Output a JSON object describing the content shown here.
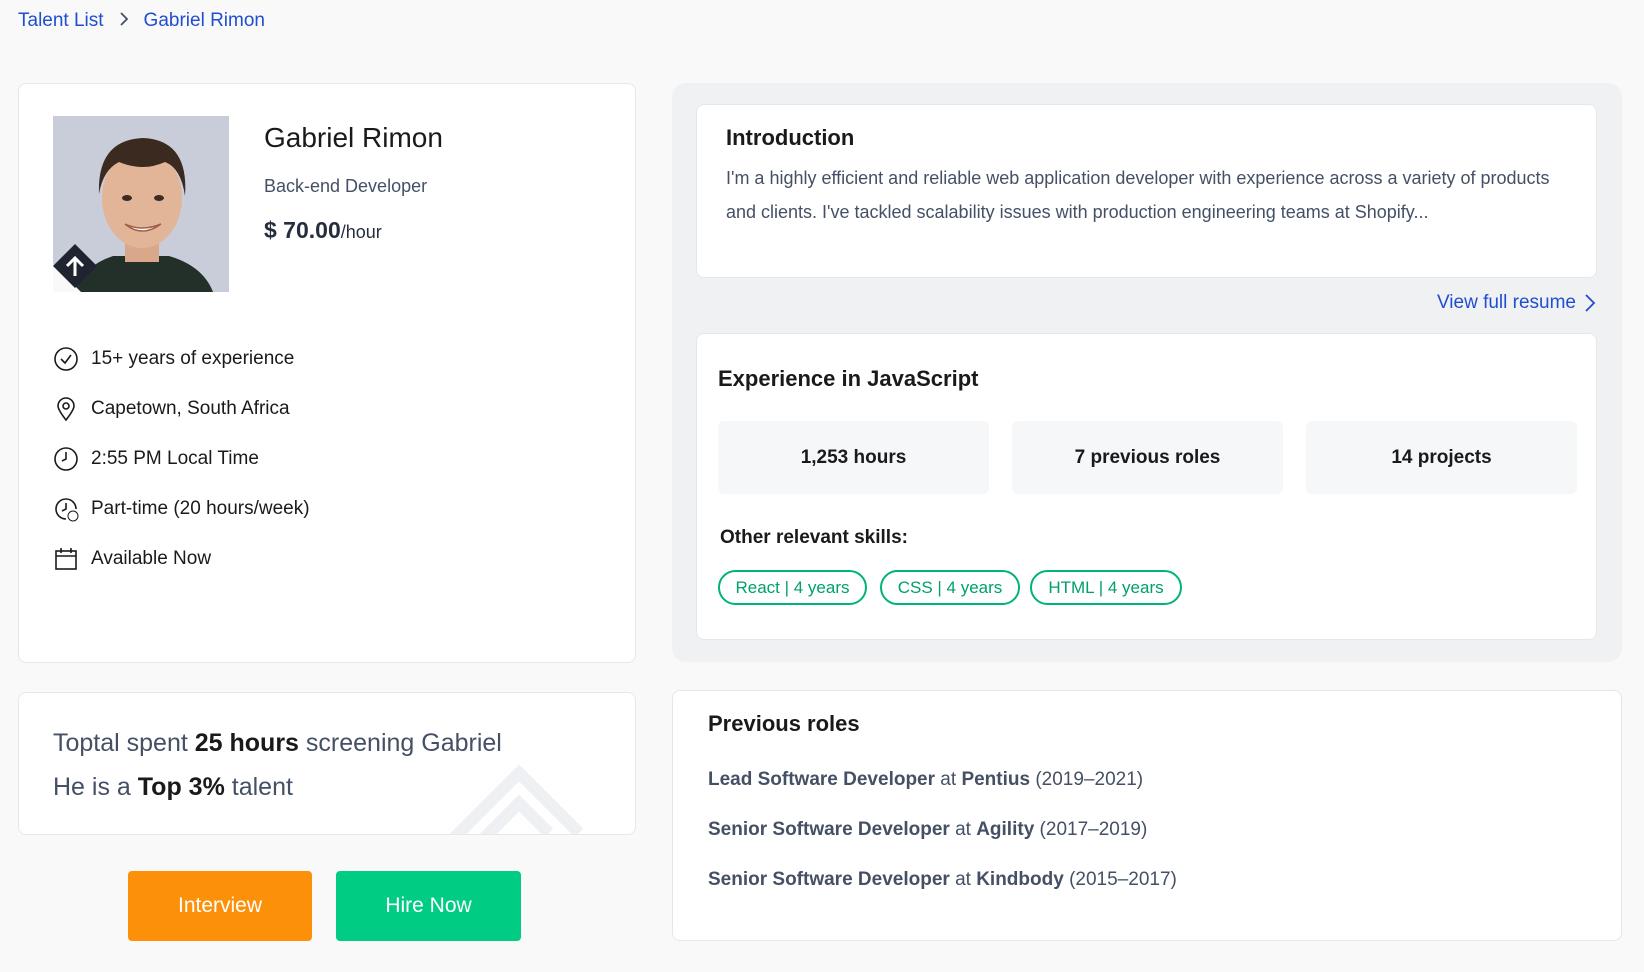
{
  "breadcrumb": {
    "parent": "Talent List",
    "separator": ">",
    "current": "Gabriel Rimon"
  },
  "profile": {
    "name": "Gabriel Rimon",
    "role": "Back-end Developer",
    "rate_amount": "$ 70.00",
    "rate_unit": "/hour",
    "facts": [
      {
        "icon": "check-circle-icon",
        "text": "15+ years of experience"
      },
      {
        "icon": "location-pin-icon",
        "text": "Capetown, South Africa"
      },
      {
        "icon": "clock-icon",
        "text": "2:55 PM Local Time"
      },
      {
        "icon": "part-time-clock-icon",
        "text": "Part-time (20 hours/week)"
      },
      {
        "icon": "calendar-icon",
        "text": "Available Now"
      }
    ]
  },
  "screening": {
    "line1_pre": "Toptal spent ",
    "line1_bold": "25 hours",
    "line1_post": " screening Gabriel",
    "line2_pre": "He is a ",
    "line2_bold": "Top 3%",
    "line2_post": " talent"
  },
  "actions": {
    "interview": "Interview",
    "hire": "Hire Now"
  },
  "introduction": {
    "title": "Introduction",
    "text": "I'm a highly efficient and reliable web application developer with experience across a variety of products and clients. I've tackled scalability issues with production engineering teams at Shopify...",
    "resume_link": "View full resume"
  },
  "experience": {
    "title": "Experience in JavaScript",
    "stats": [
      "1,253 hours",
      "7 previous roles",
      "14 projects"
    ],
    "skills_label": "Other relevant skills:",
    "skills": [
      "React | 4 years",
      "CSS | 4 years",
      "HTML | 4 years"
    ]
  },
  "previous_roles": {
    "title": "Previous roles",
    "connector": " at ",
    "items": [
      {
        "role": "Lead Software Developer",
        "company": "Pentius",
        "years": " (2019–2021)"
      },
      {
        "role": "Senior Software Developer",
        "company": "Agility",
        "years": " (2017–2019)"
      },
      {
        "role": "Senior Software Developer",
        "company": "Kindbody",
        "years": " (2015–2017)"
      }
    ]
  },
  "colors": {
    "link_blue": "#204ecf",
    "interview_orange": "#fc9008",
    "hire_green": "#00cc83",
    "chip_green": "#00b377"
  }
}
